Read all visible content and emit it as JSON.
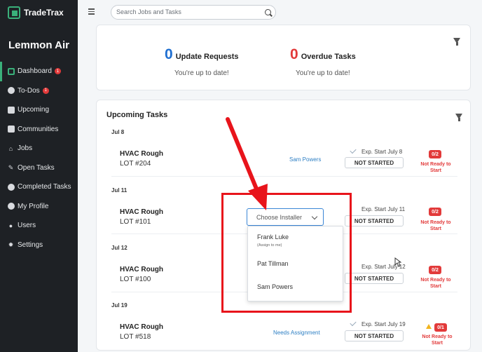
{
  "app": {
    "logo_text": "TradeTrax",
    "company": "Lemmon Air"
  },
  "sidebar": {
    "items": [
      {
        "label": "Dashboard",
        "icon": "dashboard-icon",
        "badge": "1",
        "active": true
      },
      {
        "label": "To-Dos",
        "icon": "check-circle-icon",
        "badge": "1"
      },
      {
        "label": "Upcoming",
        "icon": "clipboard-icon"
      },
      {
        "label": "Communities",
        "icon": "building-icon"
      },
      {
        "label": "Jobs",
        "icon": "home-icon"
      },
      {
        "label": "Open Tasks",
        "icon": "wrench-icon"
      },
      {
        "label": "Completed Tasks",
        "icon": "check-circle-icon"
      },
      {
        "label": "My Profile",
        "icon": "user-icon"
      },
      {
        "label": "Users",
        "icon": "users-icon"
      },
      {
        "label": "Settings",
        "icon": "gear-icon"
      }
    ]
  },
  "search": {
    "placeholder": "Search Jobs and Tasks"
  },
  "summary": {
    "update_requests": {
      "count": "0",
      "label": "Update Requests",
      "sub": "You're up to date!",
      "color": "#1f6fd1"
    },
    "overdue_tasks": {
      "count": "0",
      "label": "Overdue Tasks",
      "sub": "You're up to date!",
      "color": "#e23a3a"
    }
  },
  "upcoming": {
    "title": "Upcoming Tasks",
    "groups": [
      {
        "date": "Jul 8",
        "task": "HVAC Rough",
        "lot": "LOT #204",
        "assignee": "Sam Powers",
        "exp": "Exp. Start July 8",
        "status": "NOT STARTED",
        "badge": "0/2",
        "readiness": "Not Ready to Start"
      },
      {
        "date": "Jul 11",
        "task": "HVAC Rough",
        "lot": "LOT #101",
        "assignee": "",
        "exp": "Exp. Start July 11",
        "status": "NOT STARTED",
        "badge": "0/2",
        "readiness": "Not Ready to Start"
      },
      {
        "date": "Jul 12",
        "task": "HVAC Rough",
        "lot": "LOT #100",
        "assignee": "",
        "exp": "Exp. Start July 12",
        "status": "NOT STARTED",
        "badge": "0/2",
        "readiness": "Not Ready to Start"
      },
      {
        "date": "Jul 19",
        "task": "HVAC Rough",
        "lot": "LOT #518",
        "assignee": "Needs Assignment",
        "exp": "Exp. Start July 19",
        "status": "NOT STARTED",
        "badge": "0/1",
        "readiness": "Not Ready to Start"
      }
    ]
  },
  "installer_select": {
    "label": "Choose Installer",
    "options": [
      {
        "name": "Frank Luke",
        "sub": "(Assign to me)"
      },
      {
        "name": "Pat Tillman"
      },
      {
        "name": "Sam Powers"
      }
    ]
  }
}
